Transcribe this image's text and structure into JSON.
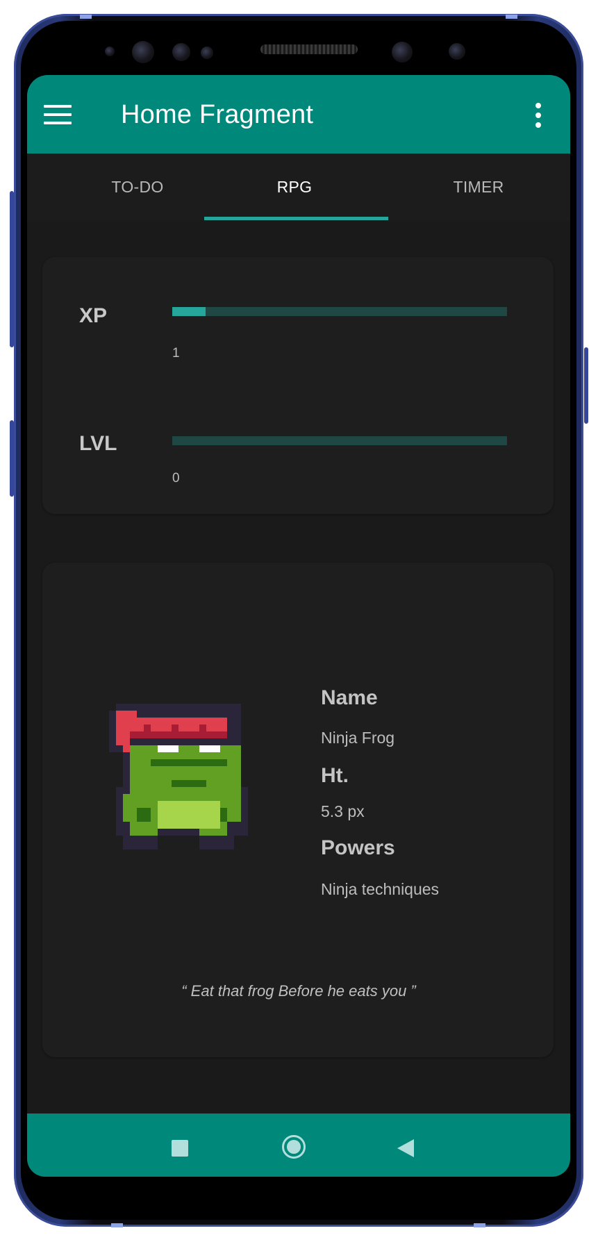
{
  "appbar": {
    "title": "Home Fragment",
    "menu_icon": "hamburger-menu-icon",
    "overflow_icon": "more-vert-icon"
  },
  "tabs": [
    {
      "label": "TO-DO",
      "active": false
    },
    {
      "label": "RPG",
      "active": true
    },
    {
      "label": "TIMER",
      "active": false
    }
  ],
  "stats": {
    "xp": {
      "label": "XP",
      "value": "1",
      "progress_fraction": 0.1
    },
    "lvl": {
      "label": "LVL",
      "value": "0",
      "progress_fraction": 0
    }
  },
  "character": {
    "name_heading": "Name",
    "name": "Ninja Frog",
    "height_heading": "Ht.",
    "height": "5.3 px",
    "powers_heading": "Powers",
    "powers": "Ninja techniques",
    "quote": "“ Eat that frog Before he eats you ”",
    "avatar_icon": "ninja-frog-sprite"
  },
  "navbar": {
    "recents_icon": "square-recents-icon",
    "home_icon": "circle-home-icon",
    "back_icon": "triangle-back-icon"
  },
  "colors": {
    "primary": "#00897b",
    "accent": "#26a69a",
    "background": "#1a1a1a",
    "card": "#1e1e1e"
  }
}
